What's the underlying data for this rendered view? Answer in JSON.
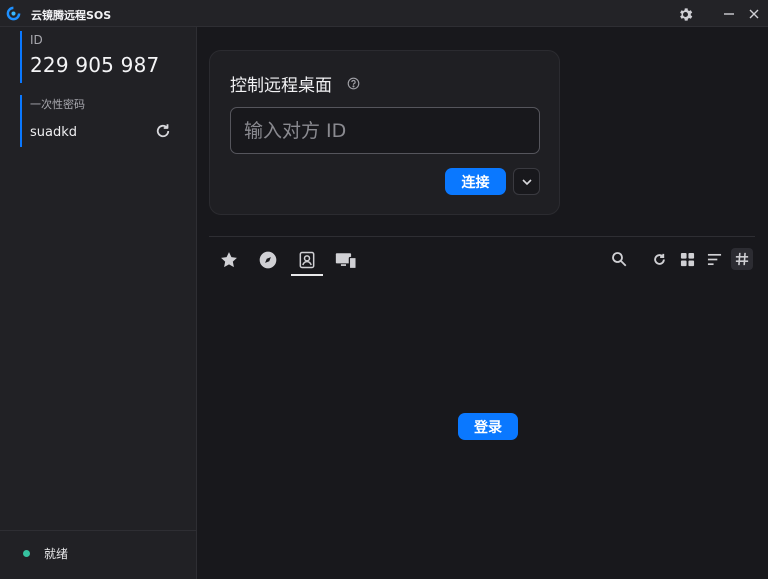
{
  "window": {
    "title": "云镜腾远程SOS"
  },
  "sidebar": {
    "id_label": "ID",
    "id_value": "229 905 987",
    "password_label": "一次性密码",
    "password_value": "suadkd",
    "status_text": "就绪",
    "status_color": "#36c2a0"
  },
  "connect": {
    "title": "控制远程桌面",
    "input_placeholder": "输入对方 ID",
    "input_value": "",
    "connect_label": "连接"
  },
  "tabs": [
    {
      "icon": "star-icon",
      "name": "favorites"
    },
    {
      "icon": "compass-icon",
      "name": "discovered"
    },
    {
      "icon": "address-book-icon",
      "name": "address-book",
      "active": true
    },
    {
      "icon": "devices-icon",
      "name": "recent-devices"
    }
  ],
  "toolbar": {
    "icons": [
      "search-icon",
      "refresh-icon",
      "grid-view-icon",
      "sort-icon",
      "hash-icon"
    ]
  },
  "main": {
    "login_label": "登录"
  },
  "colors": {
    "accent": "#0a78ff",
    "background": "#18181c",
    "panel": "#212125"
  }
}
